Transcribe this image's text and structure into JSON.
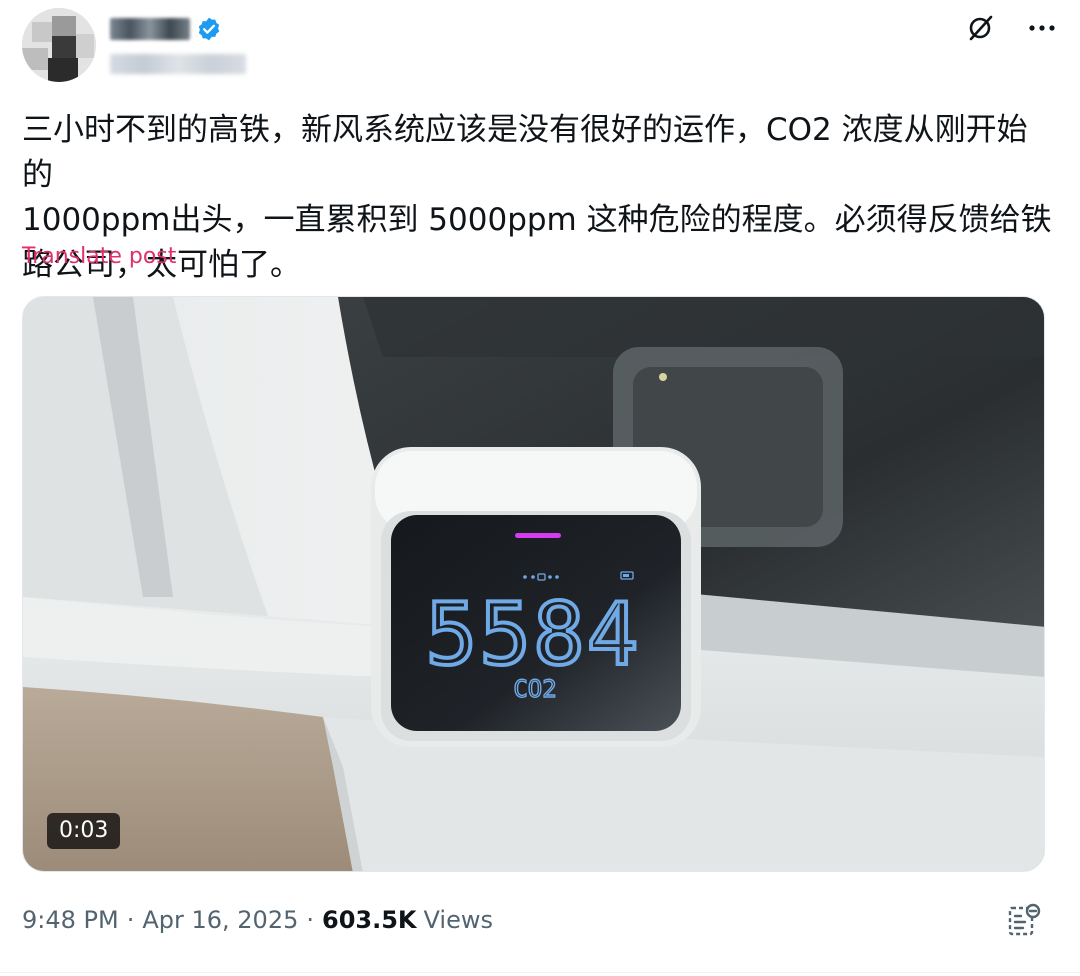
{
  "author": {
    "display_name": "",
    "handle": "",
    "verified": true
  },
  "icons": {
    "grok": "grok-icon",
    "more": "more-icon",
    "stats": "analytics-icon",
    "verified": "verified-badge-icon"
  },
  "post": {
    "text": "三小时不到的高铁，新风系统应该是没有很好的运作，CO2 浓度从刚开始的\n1000ppm出头，一直累积到 5000ppm 这种危险的程度。必须得反馈给铁\n路公司，太可怕了。",
    "translate_label": "Translate post"
  },
  "media": {
    "type": "video",
    "duration": "0:03",
    "device_reading": "5584",
    "device_label": "CO2"
  },
  "meta": {
    "time": "9:48 PM",
    "date": "Apr 16, 2025",
    "separator": "·",
    "views_count": "603.5K",
    "views_label": "Views"
  },
  "colors": {
    "translate_link": "#e0306a",
    "verified": "#1d9bf0",
    "meta_text": "#536471",
    "display_glow": "#6fa9e6",
    "indicator": "#d43cf0"
  }
}
